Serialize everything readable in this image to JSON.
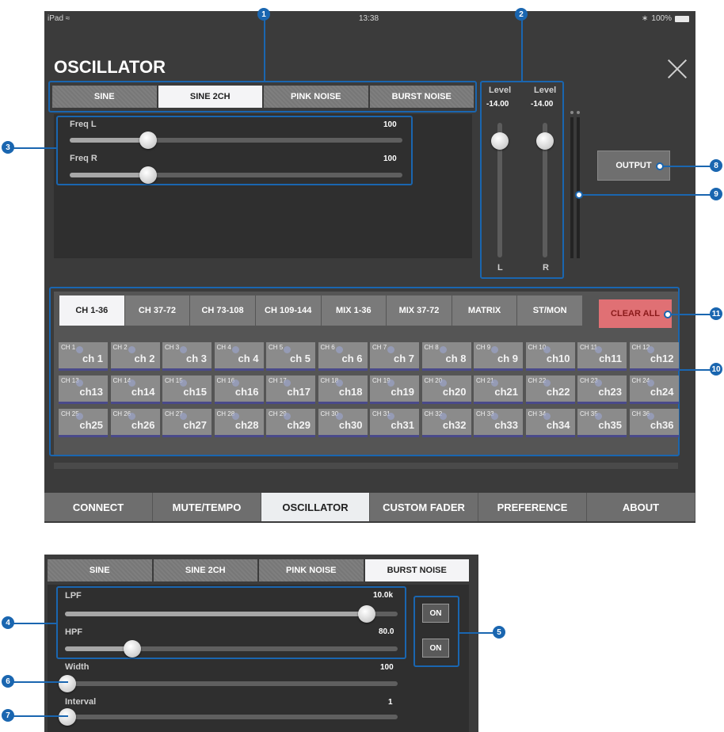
{
  "status": {
    "device": "iPad",
    "time": "13:38",
    "battery": "100%"
  },
  "title": "OSCILLATOR",
  "waveform_tabs": [
    "SINE",
    "SINE 2CH",
    "PINK NOISE",
    "BURST NOISE"
  ],
  "active_waveform_top": 1,
  "freq": {
    "l": {
      "label": "Freq L",
      "value": "100",
      "level": 0.24
    },
    "r": {
      "label": "Freq R",
      "value": "100",
      "level": 0.24
    }
  },
  "levels": {
    "l": {
      "label": "Level",
      "value": "-14.00",
      "channel": "L"
    },
    "r": {
      "label": "Level",
      "value": "-14.00",
      "channel": "R"
    }
  },
  "output_button": "OUTPUT",
  "clear_all_button": "CLEAR ALL",
  "channel_tabs": [
    "CH 1-36",
    "CH 37-72",
    "CH 73-108",
    "CH 109-144",
    "MIX 1-36",
    "MIX 37-72",
    "MATRIX",
    "ST/MON"
  ],
  "active_channel_tab": 0,
  "nav_tabs": [
    "CONNECT",
    "MUTE/TEMPO",
    "OSCILLATOR",
    "CUSTOM FADER",
    "PREFERENCE",
    "ABOUT"
  ],
  "active_nav": 2,
  "burst": {
    "active_waveform": 3,
    "lpf": {
      "label": "LPF",
      "value": "10.0k",
      "level": 0.91,
      "on": "ON"
    },
    "hpf": {
      "label": "HPF",
      "value": "80.0",
      "level": 0.2,
      "on": "ON"
    },
    "width": {
      "label": "Width",
      "value": "100",
      "level": 0.0
    },
    "interval": {
      "label": "Interval",
      "value": "1",
      "level": 0.0
    }
  },
  "callouts": [
    "1",
    "2",
    "3",
    "4",
    "5",
    "6",
    "7",
    "8",
    "9",
    "10",
    "11"
  ],
  "colors": {
    "callout": "#1a66b0",
    "clear_all": "#e07074",
    "background": "#3b3b3b"
  }
}
